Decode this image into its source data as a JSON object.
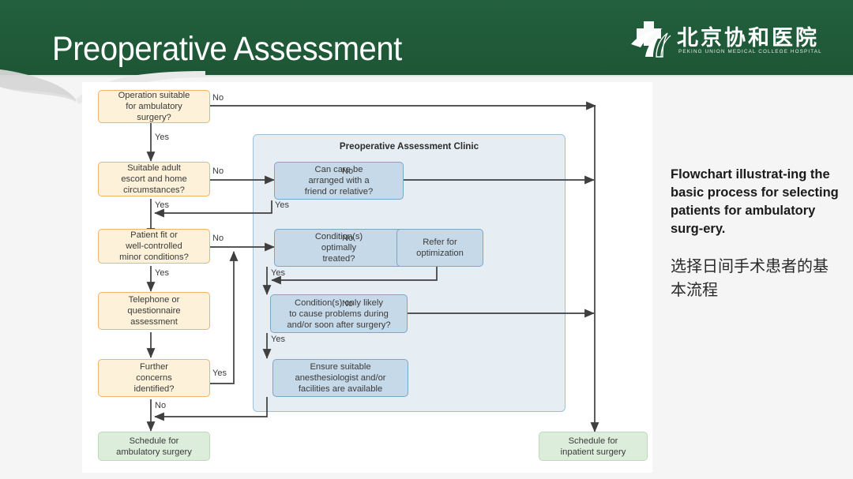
{
  "header": {
    "title": "Preoperative Assessment",
    "bg_color": "#1e5b3a",
    "logo": {
      "name_cn": "北京协和医院",
      "name_en": "PEKING UNION MEDICAL COLLEGE HOSPITAL",
      "mark": "hospital-cross-bird-logo"
    }
  },
  "chart_data": {
    "type": "diagram",
    "title": "Flowchart for selecting patients for ambulatory surgery",
    "clinic_group_label": "Preoperative Assessment Clinic",
    "nodes": [
      {
        "id": "n1",
        "label": "Operation suitable\nfor ambulatory\nsurgery?",
        "kind": "decision",
        "color": "cream"
      },
      {
        "id": "n2",
        "label": "Suitable adult\nescort and home\ncircumstances?",
        "kind": "decision",
        "color": "cream"
      },
      {
        "id": "n3",
        "label": "Patient fit or\nwell-controlled\nminor conditions?",
        "kind": "decision",
        "color": "cream"
      },
      {
        "id": "n4",
        "label": "Telephone or\nquestionnaire\nassessment",
        "kind": "process",
        "color": "cream"
      },
      {
        "id": "n5",
        "label": "Further\nconcerns\nidentified?",
        "kind": "decision",
        "color": "cream"
      },
      {
        "id": "c1",
        "label": "Can care be\narranged with a\nfriend or relative?",
        "kind": "decision",
        "color": "blue"
      },
      {
        "id": "c2",
        "label": "Condition(s)\noptimally\ntreated?",
        "kind": "decision",
        "color": "blue"
      },
      {
        "id": "c3",
        "label": "Refer for\noptimization",
        "kind": "process",
        "color": "blue"
      },
      {
        "id": "c4",
        "label": "Condition(s) only likely\nto cause problems during\nand/or soon after surgery?",
        "kind": "decision",
        "color": "blue"
      },
      {
        "id": "c5",
        "label": "Ensure suitable\nanesthesiologist and/or\nfacilities are available",
        "kind": "process",
        "color": "blue"
      },
      {
        "id": "t1",
        "label": "Schedule for\nambulatory surgery",
        "kind": "terminal",
        "color": "green"
      },
      {
        "id": "t2",
        "label": "Schedule for\ninpatient surgery",
        "kind": "terminal",
        "color": "green"
      }
    ],
    "edge_labels": [
      {
        "id": "e1",
        "text": "No",
        "from": "n1"
      },
      {
        "id": "e2",
        "text": "Yes",
        "from": "n1"
      },
      {
        "id": "e3",
        "text": "No",
        "from": "n2"
      },
      {
        "id": "e4",
        "text": "Yes",
        "from": "n2"
      },
      {
        "id": "e5",
        "text": "No",
        "from": "n3"
      },
      {
        "id": "e6",
        "text": "Yes",
        "from": "n3"
      },
      {
        "id": "e7",
        "text": "Yes",
        "from": "n5"
      },
      {
        "id": "e8",
        "text": "No",
        "from": "n5"
      },
      {
        "id": "e9",
        "text": "No",
        "from": "c1"
      },
      {
        "id": "e10",
        "text": "Yes",
        "from": "c1"
      },
      {
        "id": "e11",
        "text": "No",
        "from": "c2"
      },
      {
        "id": "e12",
        "text": "Yes",
        "from": "c2"
      },
      {
        "id": "e13",
        "text": "No",
        "from": "c4"
      },
      {
        "id": "e14",
        "text": "Yes",
        "from": "c4"
      }
    ],
    "colors": {
      "cream_fill": "#fdf2d9",
      "cream_border": "#f0b46a",
      "blue_fill": "#c6d9e8",
      "blue_border": "#7ba7c7",
      "green_fill": "#dceedb",
      "green_border": "#bcd9b8",
      "group_fill": "#e6eef4",
      "group_border": "#9dc0d8",
      "wire": "#3f3f3f"
    }
  },
  "caption": {
    "english": "Flowchart illustrat-ing the basic process for selecting patients for ambulatory surg-ery.",
    "chinese": "选择日间手术患者的基本流程"
  }
}
